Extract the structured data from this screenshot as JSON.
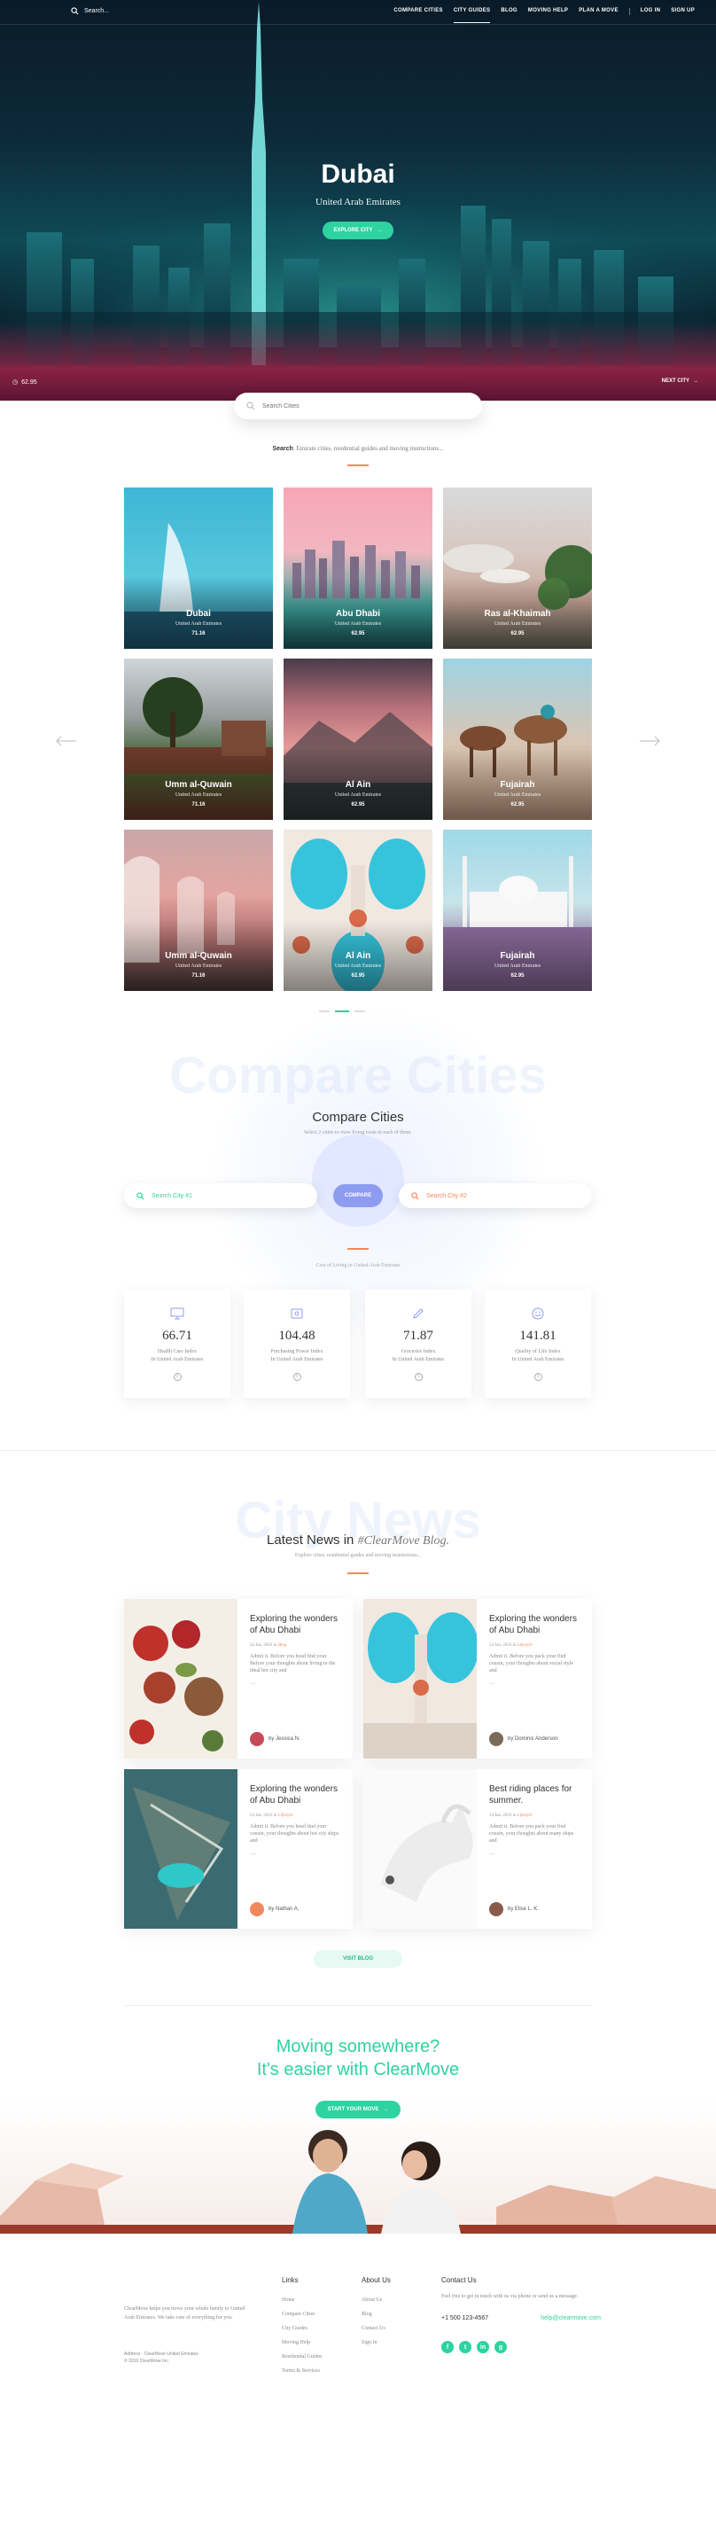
{
  "topbar": {
    "search_placeholder": "Search...",
    "nav": [
      "COMPARE CITIES",
      "CITY GUIDES",
      "BLOG",
      "MOVING HELP",
      "PLAN A MOVE",
      "LOG IN",
      "SIGN UP"
    ]
  },
  "hero": {
    "title": "Dubai",
    "subtitle": "United Arab Emirates",
    "cta": "EXPLORE CITY",
    "score": "62.95",
    "next": "NEXT CITY"
  },
  "search": {
    "placeholder": "Search Cities",
    "hint_bold": "Search",
    "hint_rest": ": Emirate cities, residential guides and moving instructions..."
  },
  "cities": [
    {
      "name": "Dubai",
      "country": "United Arab Emirates",
      "score": "71.16"
    },
    {
      "name": "Abu Dhabi",
      "country": "United Arab Emirates",
      "score": "62.95"
    },
    {
      "name": "Ras al-Khaimah",
      "country": "United Arab Emirates",
      "score": "62.95"
    },
    {
      "name": "Umm al-Quwain",
      "country": "United Arab Emirates",
      "score": "71.16"
    },
    {
      "name": "Al Ain",
      "country": "United Arab Emirates",
      "score": "62.95"
    },
    {
      "name": "Fujairah",
      "country": "United Arab Emirates",
      "score": "62.95"
    },
    {
      "name": "Umm al-Quwain",
      "country": "United Arab Emirates",
      "score": "71.16"
    },
    {
      "name": "Al Ain",
      "country": "United Arab Emirates",
      "score": "62.95"
    },
    {
      "name": "Fujairah",
      "country": "United Arab Emirates",
      "score": "62.95"
    }
  ],
  "compare": {
    "ghost": "Compare Cities",
    "title": "Compare Cities",
    "subtitle": "Select 2 cities to view living costs in each of them.",
    "city1_placeholder": "Search City #1",
    "city2_placeholder": "Search City #2",
    "button": "COMPARE",
    "note": "Cost of Living in United Arab Emirates",
    "stats": [
      {
        "value": "66.71",
        "label1": "Health Care Index",
        "label2": "In United Arab Emirates",
        "icon": "monitor-icon"
      },
      {
        "value": "104.48",
        "label1": "Purchasing Power Index",
        "label2": "In United Arab Emirates",
        "icon": "card-icon"
      },
      {
        "value": "71.87",
        "label1": "Groceries Index",
        "label2": "In United Arab Emirates",
        "icon": "pen-icon"
      },
      {
        "value": "141.81",
        "label1": "Quality of Life Index",
        "label2": "In United Arab Emirates",
        "icon": "smile-icon"
      }
    ]
  },
  "news": {
    "ghost": "City News",
    "title_lead": "Latest News in ",
    "title_italic": "#ClearMove Blog.",
    "subtitle": "Explore cities, residential guides and moving instructions...",
    "posts": [
      {
        "title": "Exploring the wonders of Abu Dhabi",
        "date": "24 Jan, 2016 in",
        "tag": "Blog",
        "excerpt": "Admit it. Before you head find your. Before your thoughts about living in the ideal hot city and",
        "more": "...",
        "author": "by Jessica N."
      },
      {
        "title": "Exploring the wonders of Abu Dhabi",
        "date": "24 Jan, 2016 in",
        "tag": "Lifestyle",
        "excerpt": "Admit it. Before you pack your find cousin, your thoughts about social style and",
        "more": "...",
        "author": "by Dominic Anderson"
      },
      {
        "title": "Exploring the wonders of Abu Dhabi",
        "date": "24 Jan, 2016 in",
        "tag": "Lifestyle",
        "excerpt": "Admit it. Before you head find your cousin, your thoughts about hot city ships and",
        "more": "...",
        "author": "by Nathan A."
      },
      {
        "title": "Best riding places for summer.",
        "date": "24 Jan, 2016 in",
        "tag": "Lifestyle",
        "excerpt": "Admit it. Before you pack your find cousin, your thoughts about many ships and",
        "more": "...",
        "author": "by Elise L. K."
      }
    ],
    "visit": "VISIT BLOG"
  },
  "moving": {
    "line1": "Moving somewhere?",
    "line2": "It's easier with ClearMove",
    "cta": "START YOUR MOVE"
  },
  "footer": {
    "about": "ClearMove helps you move your whole family to United Arab Emirates. We take care of everything for you.",
    "address1": "Address · ClearMove United Emirates",
    "address2": "© 2016 ClearMove Inc.",
    "links_title": "Links",
    "links": [
      "Home",
      "Compare Cities",
      "City Guides",
      "Moving Help",
      "Residential Guides",
      "Terms & Services"
    ],
    "about_title": "About Us",
    "about_links": [
      "About Us",
      "Blog",
      "Contact Us",
      "Sign In"
    ],
    "contact_title": "Contact Us",
    "contact_text": "Feel free to get in touch with us via phone or send us a message.",
    "phone": "+1 500 123-4567",
    "email": "help@clearmove.com",
    "socials": [
      "f",
      "t",
      "in",
      "g"
    ]
  },
  "colors": {
    "accent": "#2ed3a0",
    "orange": "#f08a5d",
    "compare_button": "#8e9cf0"
  }
}
